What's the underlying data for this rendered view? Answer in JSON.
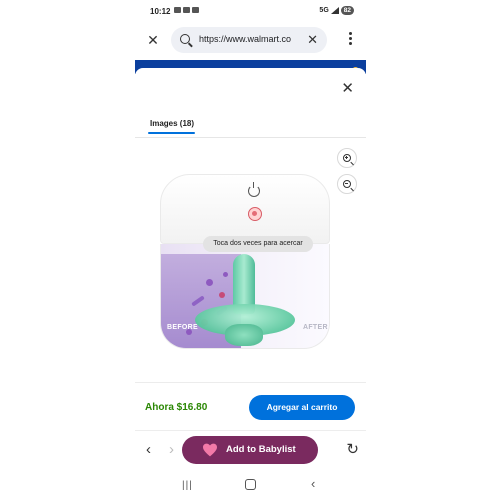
{
  "status_bar": {
    "time": "10:12",
    "network": "5G",
    "battery": "82"
  },
  "browser": {
    "url": "https://www.walmart.co",
    "close_icon": "close-icon",
    "clear_icon": "clear-icon",
    "menu_icon": "more-vertical-icon"
  },
  "modal": {
    "tab_label": "Images (18)",
    "zoom_in_icon": "zoom-in-icon",
    "zoom_out_icon": "zoom-out-icon",
    "tooltip": "Toca dos veces para acercar",
    "image_labels": {
      "before": "BEFORE",
      "after": "AFTER"
    }
  },
  "purchase": {
    "price": "Ahora $16.80",
    "add_to_cart": "Agregar al carrito",
    "price_color": "#2a8703",
    "button_color": "#0071dc"
  },
  "toolbar": {
    "back_glyph": "‹",
    "forward_glyph": "›",
    "babylist_label": "Add to Babylist",
    "babylist_color": "#7a2a5f",
    "reload_glyph": "↻"
  },
  "android_nav": {
    "recents_glyph": "|||",
    "back_glyph": "‹"
  }
}
